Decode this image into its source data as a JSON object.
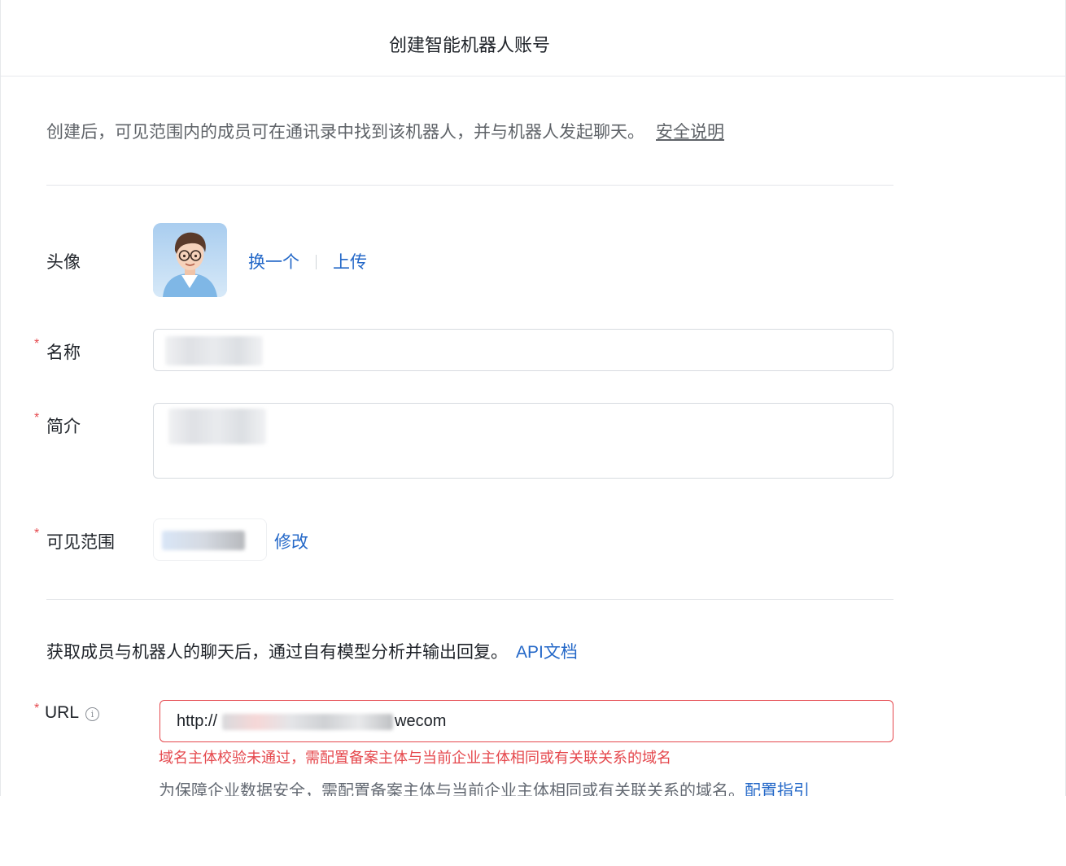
{
  "dialog": {
    "title": "创建智能机器人账号"
  },
  "intro": {
    "text": "创建后，可见范围内的成员可在通讯录中找到该机器人，并与机器人发起聊天。",
    "link": "安全说明"
  },
  "form": {
    "avatar": {
      "label": "头像",
      "change": "换一个",
      "upload": "上传"
    },
    "name": {
      "required_mark": "*",
      "label": "名称"
    },
    "intro_field": {
      "required_mark": "*",
      "label": "简介"
    },
    "scope": {
      "required_mark": "*",
      "label": "可见范围",
      "edit": "修改"
    }
  },
  "callback": {
    "text": "获取成员与机器人的聊天后，通过自有模型分析并输出回复。",
    "link": "API文档",
    "url": {
      "required_mark": "*",
      "label": "URL",
      "info_icon": "i",
      "value_prefix": "http://",
      "value_suffix": "wecom",
      "error": "域名主体校验未通过，需配置备案主体与当前企业主体相同或有关联关系的域名",
      "hint": "为保障企业数据安全，需配置备案主体与当前企业主体相同或有关联关系的域名。",
      "hint_link": "配置指引"
    }
  },
  "colors": {
    "link": "#2468c8",
    "error": "#e5484d",
    "border": "#d7dbe0"
  }
}
